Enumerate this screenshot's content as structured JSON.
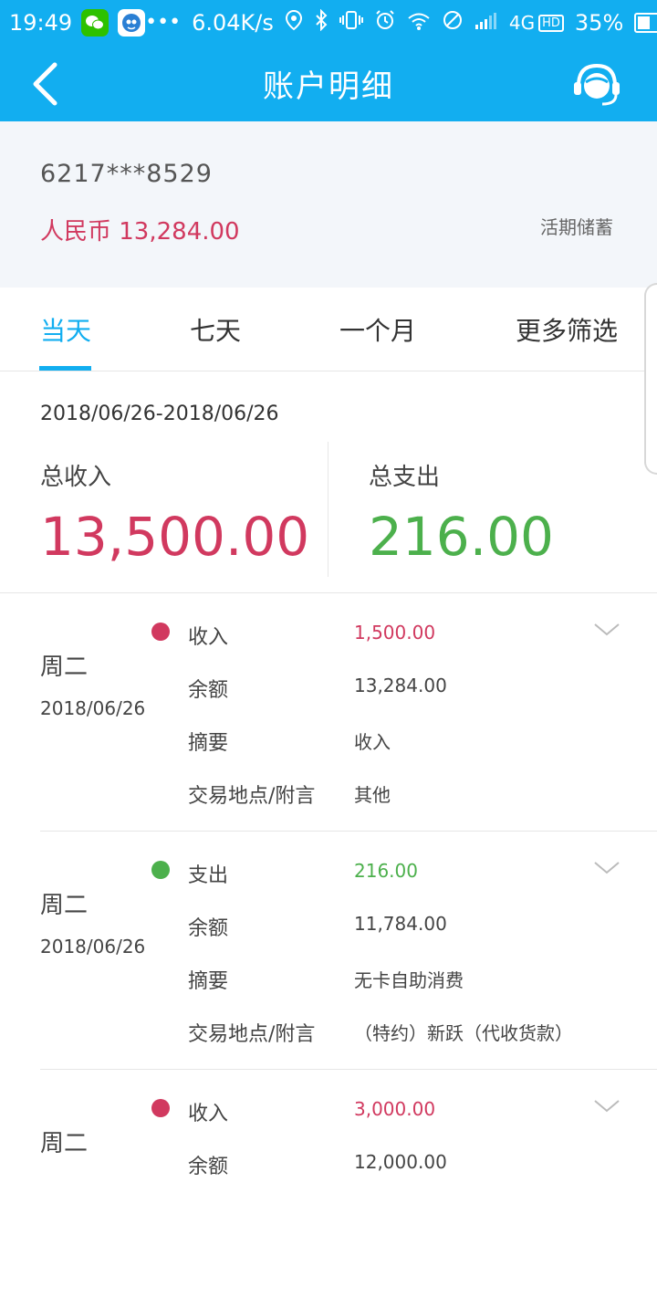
{
  "status_bar": {
    "time": "19:49",
    "more": "•••",
    "net_speed": "6.04K/s",
    "network": "4G",
    "hd": "HD",
    "battery_text": "35%",
    "battery_level": 0.35
  },
  "header": {
    "title": "账户明细"
  },
  "account": {
    "number": "6217***8529",
    "balance": "人民币 13,284.00",
    "type": "活期储蓄"
  },
  "tabs": [
    {
      "label": "当天",
      "active": true
    },
    {
      "label": "七天",
      "active": false
    },
    {
      "label": "一个月",
      "active": false
    },
    {
      "label": "更多筛选",
      "active": false
    }
  ],
  "summary": {
    "range": "2018/06/26-2018/06/26",
    "income_label": "总收入",
    "income_value": "13,500.00",
    "expense_label": "总支出",
    "expense_value": "216.00"
  },
  "transactions": [
    {
      "weekday": "周二",
      "date": "2018/06/26",
      "kind": "in",
      "type_label": "收入",
      "amount": "1,500.00",
      "balance_label": "余额",
      "balance": "13,284.00",
      "summary_label": "摘要",
      "summary": "收入",
      "place_label": "交易地点/附言",
      "place": "其他"
    },
    {
      "weekday": "周二",
      "date": "2018/06/26",
      "kind": "out",
      "type_label": "支出",
      "amount": "216.00",
      "balance_label": "余额",
      "balance": "11,784.00",
      "summary_label": "摘要",
      "summary": "无卡自助消费",
      "place_label": "交易地点/附言",
      "place": "（特约）新跃（代收货款）"
    },
    {
      "weekday": "周二",
      "date": "",
      "kind": "in",
      "type_label": "收入",
      "amount": "3,000.00",
      "balance_label": "余额",
      "balance": "12,000.00",
      "summary_label": "",
      "summary": "",
      "place_label": "",
      "place": ""
    }
  ],
  "colors": {
    "primary": "#12aef0",
    "income": "#d1395f",
    "expense": "#4cb04c"
  }
}
